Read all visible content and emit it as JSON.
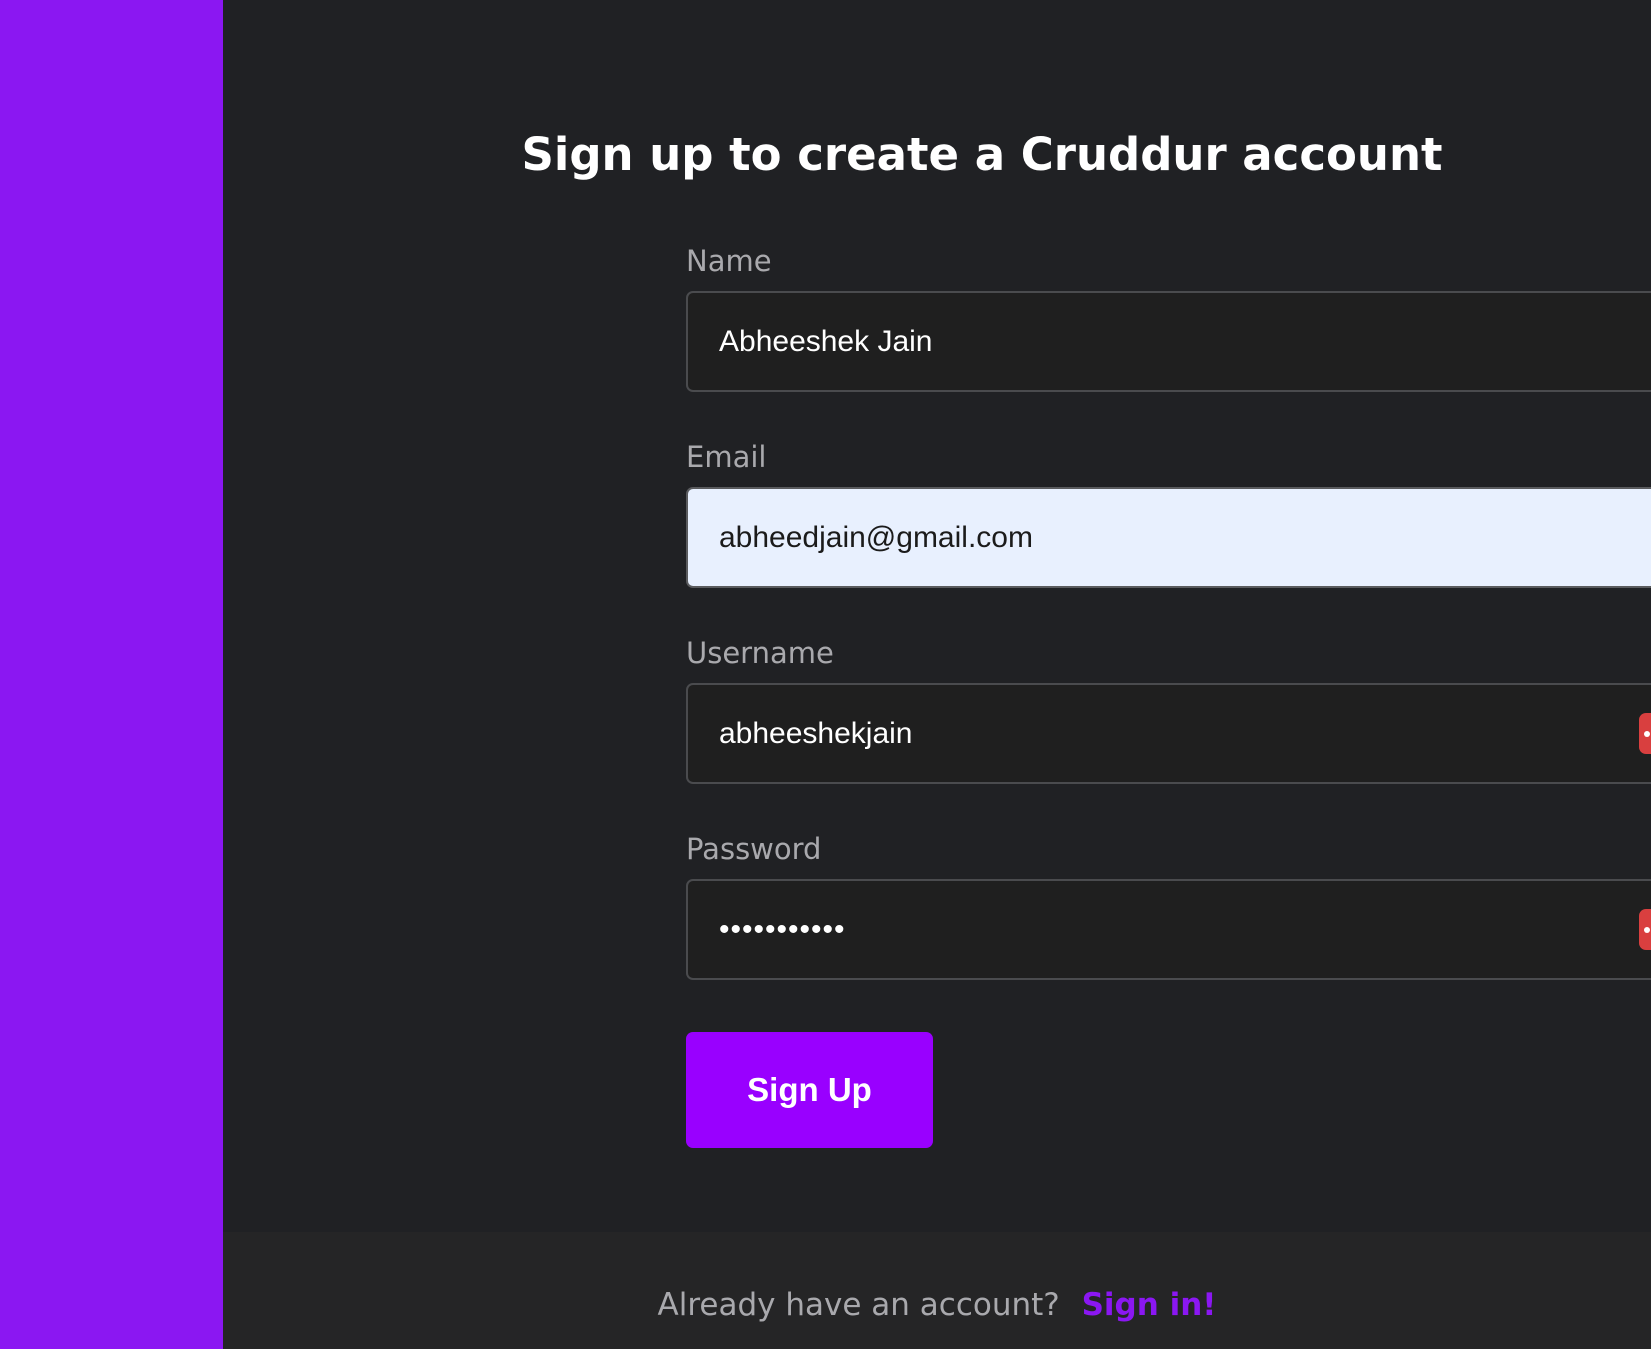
{
  "page": {
    "title": "Sign up to create a Cruddur account"
  },
  "form": {
    "name": {
      "label": "Name",
      "value": "Abheeshek Jain"
    },
    "email": {
      "label": "Email",
      "value": "abheedjain@gmail.com"
    },
    "username": {
      "label": "Username",
      "value": "abheeshekjain"
    },
    "password": {
      "label": "Password",
      "value": "abheeshekja"
    },
    "submit_label": "Sign Up"
  },
  "footer": {
    "prompt": "Already have an account?",
    "link_label": "Sign in!"
  },
  "colors": {
    "accent": "#8b17f2",
    "button": "#9900ff",
    "password_manager_icon": "#d93f3f"
  },
  "icons": [
    "password-manager-icon"
  ]
}
